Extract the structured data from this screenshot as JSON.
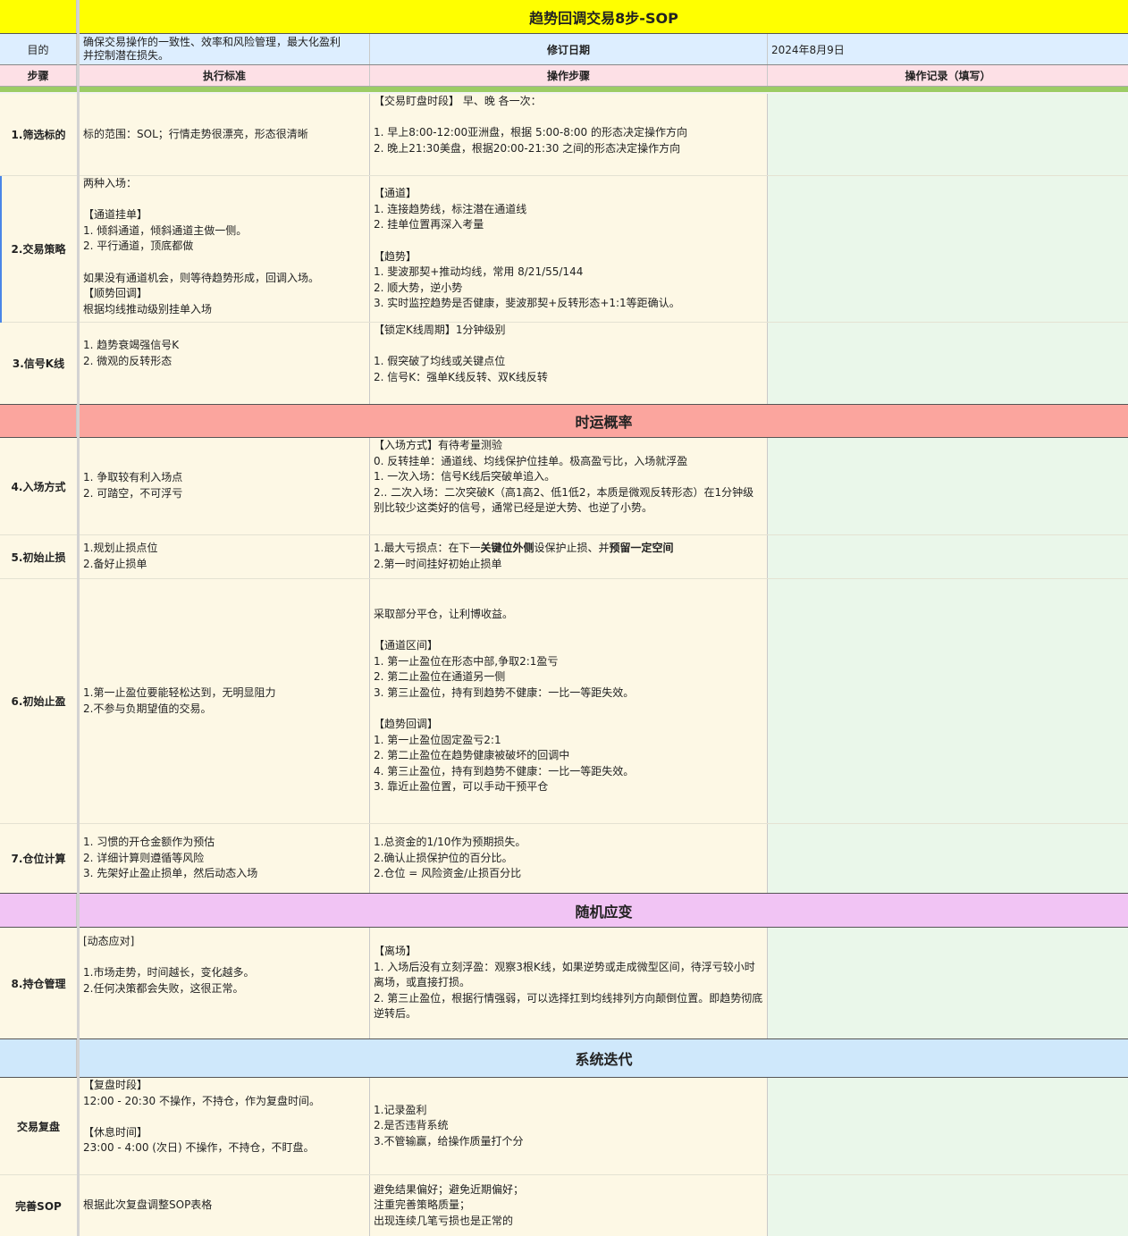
{
  "title": "趋势回调交易8步-SOP",
  "purpose_row": {
    "label": "目的",
    "text": "确保交易操作的一致性、效率和风险管理，最大化盈利\n并控制潜在损失。",
    "revision_label": "修订日期",
    "revision_date": "2024年8月9日"
  },
  "header_row": {
    "col1": "步骤",
    "col2": "执行标准",
    "col3": "操作步骤",
    "col4": "操作记录（填写）"
  },
  "sections": {
    "luck": "时运概率",
    "adapt": "随机应变",
    "iterate": "系统迭代"
  },
  "steps": [
    {
      "name": "1.筛选标的",
      "standard": "标的范围：SOL；行情走势很漂亮，形态很清晰",
      "operation": "【交易盯盘时段】 早、晚 各一次：\n\n1. 早上8:00-12:00亚洲盘，根据 5:00-8:00 的形态决定操作方向\n2. 晚上21:30美盘，根据20:00-21:30 之间的形态决定操作方向"
    },
    {
      "name": "2.交易策略",
      "standard": "两种入场：\n\n【通道挂单】\n  1. 倾斜通道，倾斜通道主做一侧。\n  2. 平行通道，顶底都做\n\n如果没有通道机会，则等待趋势形成，回调入场。\n【顺势回调】\n  根据均线推动级别挂单入场",
      "operation": "【通道】\n1. 连接趋势线，标注潜在通道线\n2. 挂单位置再深入考量\n\n【趋势】\n1. 斐波那契+推动均线，常用 8/21/55/144\n2. 顺大势，逆小势\n3. 实时监控趋势是否健康，斐波那契+反转形态+1:1等距确认。"
    },
    {
      "name": "3.信号K线",
      "standard": "1. 趋势衰竭强信号K\n2. 微观的反转形态",
      "operation": "【锁定K线周期】1分钟级别\n\n1. 假突破了均线或关键点位\n2. 信号K：强单K线反转、双K线反转"
    },
    {
      "name": "4.入场方式",
      "standard": "1. 争取较有利入场点\n2. 可踏空，不可浮亏",
      "operation": "【入场方式】有待考量测验\n0. 反转挂单：通道线、均线保护位挂单。极高盈亏比，入场就浮盈\n1.  一次入场：信号K线后突破单追入。\n2.. 二次入场：二次突破K（高1高2、低1低2，本质是微观反转形态）在1分钟级别比较少这类好的信号，通常已经是逆大势、也逆了小势。"
    },
    {
      "name": "5.初始止损",
      "standard": "1.规划止损点位\n2.备好止损单",
      "operation_a": "1.最大亏损点：在下一",
      "operation_b": "关键位外侧",
      "operation_c": "设保护止损、并",
      "operation_d": "预留一定空间",
      "operation_e": "2.第一时间挂好初始止损单"
    },
    {
      "name": "6.初始止盈",
      "standard": " 1.第一止盈位要能轻松达到，无明显阻力\n 2.不参与负期望值的交易。",
      "operation": "采取部分平仓，让利博收益。\n\n【通道区间】\n1. 第一止盈位在形态中部,争取2:1盈亏\n2. 第二止盈位在通道另一侧\n3. 第三止盈位，持有到趋势不健康：一比一等距失效。\n\n【趋势回调】\n1. 第一止盈位固定盈亏2:1\n2. 第二止盈位在趋势健康被破坏的回调中\n4. 第三止盈位，持有到趋势不健康：一比一等距失效。\n3. 靠近止盈位置，可以手动干预平仓"
    },
    {
      "name": "7.仓位计算",
      "standard": "1. 习惯的开仓金额作为预估\n2. 详细计算则遵循等风险\n3. 先架好止盈止损单，然后动态入场",
      "operation": "1.总资金的1/10作为预期损失。\n2.确认止损保护位的百分比。\n2.仓位 = 风险资金/止损百分比"
    },
    {
      "name": "8.持仓管理",
      "standard": "[动态应对]\n\n1.市场走势，时间越长，变化越多。\n2.任何决策都会失败，这很正常。",
      "operation": "【离场】\n 1. 入场后没有立刻浮盈：观察3根K线，如果逆势或走成微型区间，待浮亏较小时离场，或直接打损。\n 2. 第三止盈位，根据行情强弱，可以选择扛到均线排列方向颠倒位置。即趋势彻底逆转后。"
    },
    {
      "name": "交易复盘",
      "standard": "【复盘时段】\n12:00 - 20:30 不操作，不持仓，作为复盘时间。\n\n【休息时间】\n23:00 - 4:00 (次日) 不操作，不持仓，不盯盘。",
      "operation": "1.记录盈利\n2.是否违背系统\n3.不管输赢，给操作质量打个分"
    },
    {
      "name": "完善SOP",
      "standard": "根据此次复盘调整SOP表格",
      "operation": "避免结果偏好；避免近期偏好；\n注重完善策略质量；\n出现连续几笔亏损也是正常的"
    }
  ]
}
